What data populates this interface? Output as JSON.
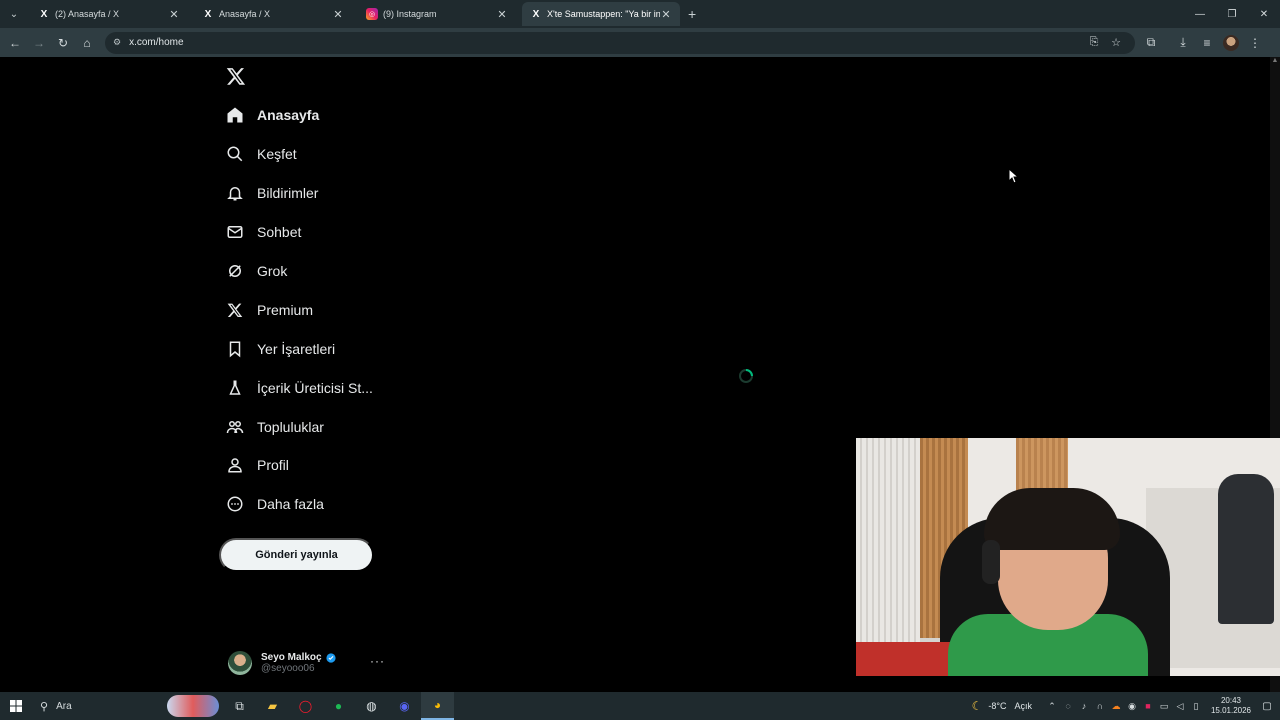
{
  "browser": {
    "tabs": [
      {
        "favicon": "X",
        "title": "(2) Anasayfa / X",
        "active": false
      },
      {
        "favicon": "X",
        "title": "Anasayfa / X",
        "active": false
      },
      {
        "favicon": "ig",
        "title": "(9) Instagram",
        "active": false
      },
      {
        "favicon": "X",
        "title": "X'te Samustappen: \"Ya bir insan",
        "active": true
      }
    ],
    "url": "x.com/home"
  },
  "sidebar": {
    "items": [
      {
        "label": "Anasayfa",
        "icon": "home-icon",
        "active": true
      },
      {
        "label": "Keşfet",
        "icon": "search-icon"
      },
      {
        "label": "Bildirimler",
        "icon": "bell-icon"
      },
      {
        "label": "Sohbet",
        "icon": "mail-icon"
      },
      {
        "label": "Grok",
        "icon": "grok-icon"
      },
      {
        "label": "Premium",
        "icon": "x-logo-icon"
      },
      {
        "label": "Yer İşaretleri",
        "icon": "bookmark-icon"
      },
      {
        "label": "İçerik Üreticisi St...",
        "icon": "flask-icon"
      },
      {
        "label": "Topluluklar",
        "icon": "communities-icon"
      },
      {
        "label": "Profil",
        "icon": "person-icon"
      },
      {
        "label": "Daha fazla",
        "icon": "more-circle-icon"
      }
    ],
    "post_button": "Gönderi yayınla"
  },
  "account": {
    "name": "Seyo Malkoç",
    "handle": "@seyooo06",
    "verified": true
  },
  "taskbar": {
    "search_placeholder": "Ara",
    "weather": {
      "temp": "-8°C",
      "condition": "Açık"
    },
    "time": "20:43",
    "date": "15.01.2026"
  },
  "colors": {
    "background": "#000000",
    "text": "#e7e9ea",
    "post_button_bg": "#eff3f4",
    "spinner": "#00ba7c",
    "verified": "#1d9bf0"
  }
}
